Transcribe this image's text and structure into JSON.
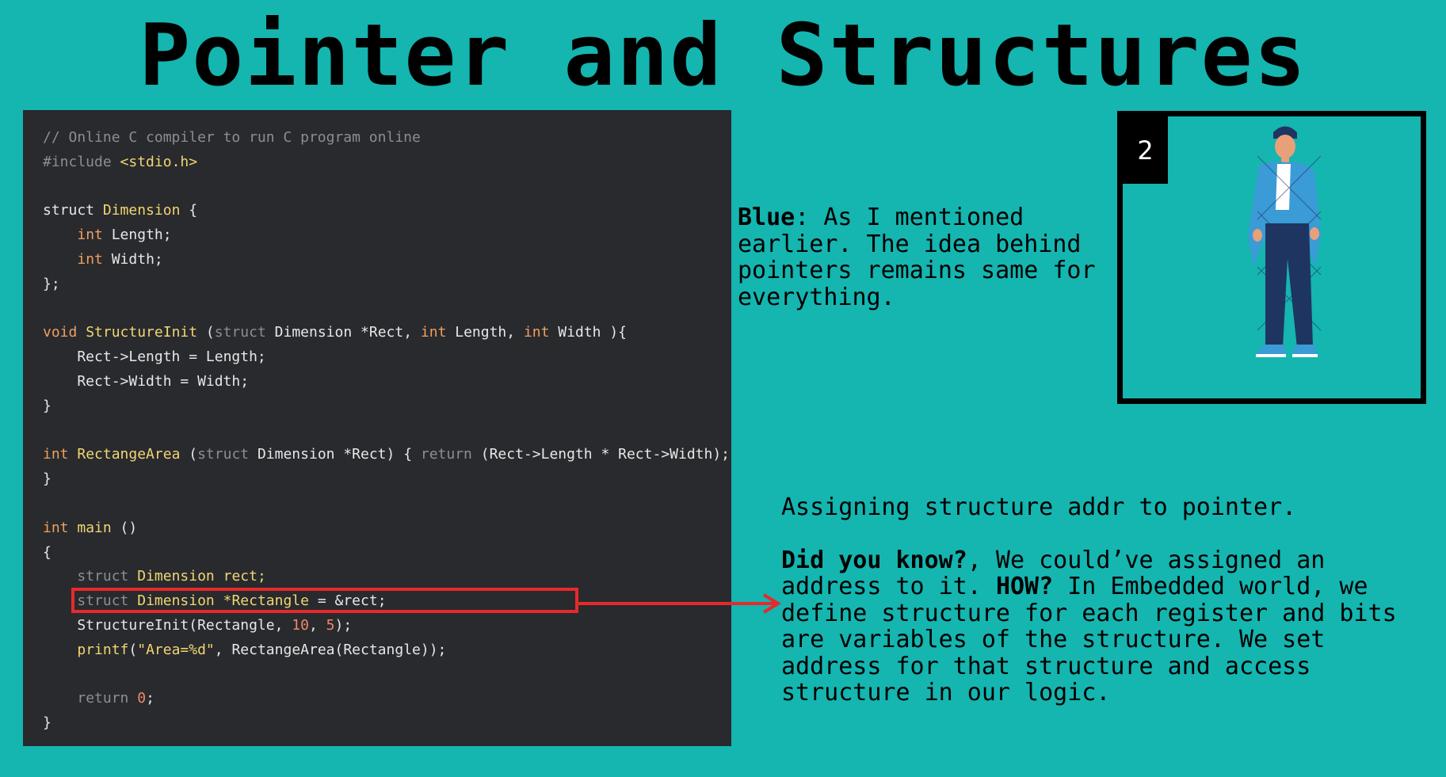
{
  "page": {
    "title": "Pointer and Structures",
    "background": "#15b5b0"
  },
  "code": {
    "comment": "// Online C compiler to run C program online",
    "include": "#include",
    "include_file": "<stdio.h>",
    "struct_kw": "struct",
    "type_dimension": "Dimension",
    "int_kw": "int",
    "void_kw": "void",
    "return_kw": "return",
    "field_length": "Length;",
    "field_width": "Width;",
    "fn_init": "StructureInit",
    "fn_area": "RectangeArea",
    "fn_main": "main",
    "var_rect": "rect;",
    "var_rectangle": "*Rectangle",
    "str_format": "\"Area=%d\"",
    "num_10": "10",
    "num_5": "5",
    "num_0": "0"
  },
  "blue_dialogue": {
    "speaker": "Blue",
    "text": ": As I mentioned earlier. The idea behind pointers remains same for everything."
  },
  "figure": {
    "number": "2",
    "icon": "person-illustration"
  },
  "info": {
    "line1": "Assigning structure addr to pointer.",
    "did_you_know": "Did you know?",
    "part1": ", We could’ve assigned an address to it. ",
    "how": "HOW?",
    "part2": " In Embedded world, we define structure for each register and bits are variables of the structure. We set address for that structure and access structure in our logic."
  },
  "colors": {
    "highlight": "#e8292b",
    "code_bg": "#282a2e",
    "keyword": "#ef9f5e",
    "type": "#f2d571",
    "comment": "#8a8f8f"
  }
}
